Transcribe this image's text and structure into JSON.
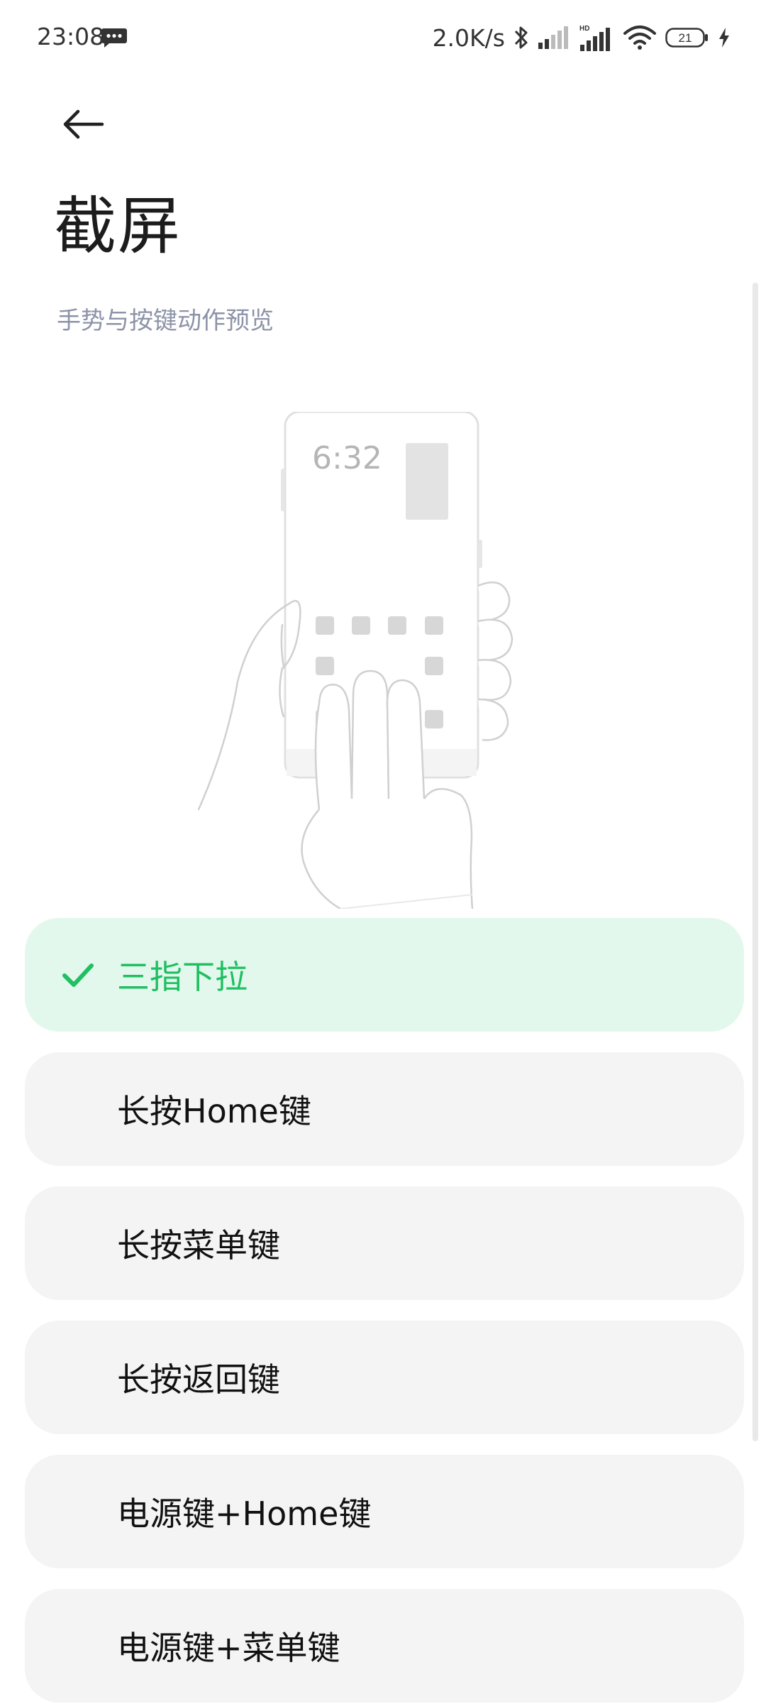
{
  "status_bar": {
    "time": "23:08",
    "network_speed": "2.0K/s",
    "battery_level": "21",
    "icons": [
      "message-icon",
      "bluetooth-icon",
      "signal-icon",
      "hd-signal-icon",
      "wifi-icon",
      "battery-icon",
      "charging-icon"
    ]
  },
  "header": {
    "back_icon": "arrow-left-icon",
    "title": "截屏"
  },
  "section": {
    "subtitle": "手势与按键动作预览"
  },
  "illustration": {
    "clock_text": "6:32"
  },
  "options": [
    {
      "label": "三指下拉",
      "selected": true
    },
    {
      "label": "长按Home键",
      "selected": false
    },
    {
      "label": "长按菜单键",
      "selected": false
    },
    {
      "label": "长按返回键",
      "selected": false
    },
    {
      "label": "电源键+Home键",
      "selected": false
    },
    {
      "label": "电源键+菜单键",
      "selected": false
    }
  ],
  "colors": {
    "accent": "#1fbf62",
    "selected_bg": "#e3f8ec",
    "option_bg": "#f4f4f4",
    "subtitle": "#8d93a8"
  }
}
